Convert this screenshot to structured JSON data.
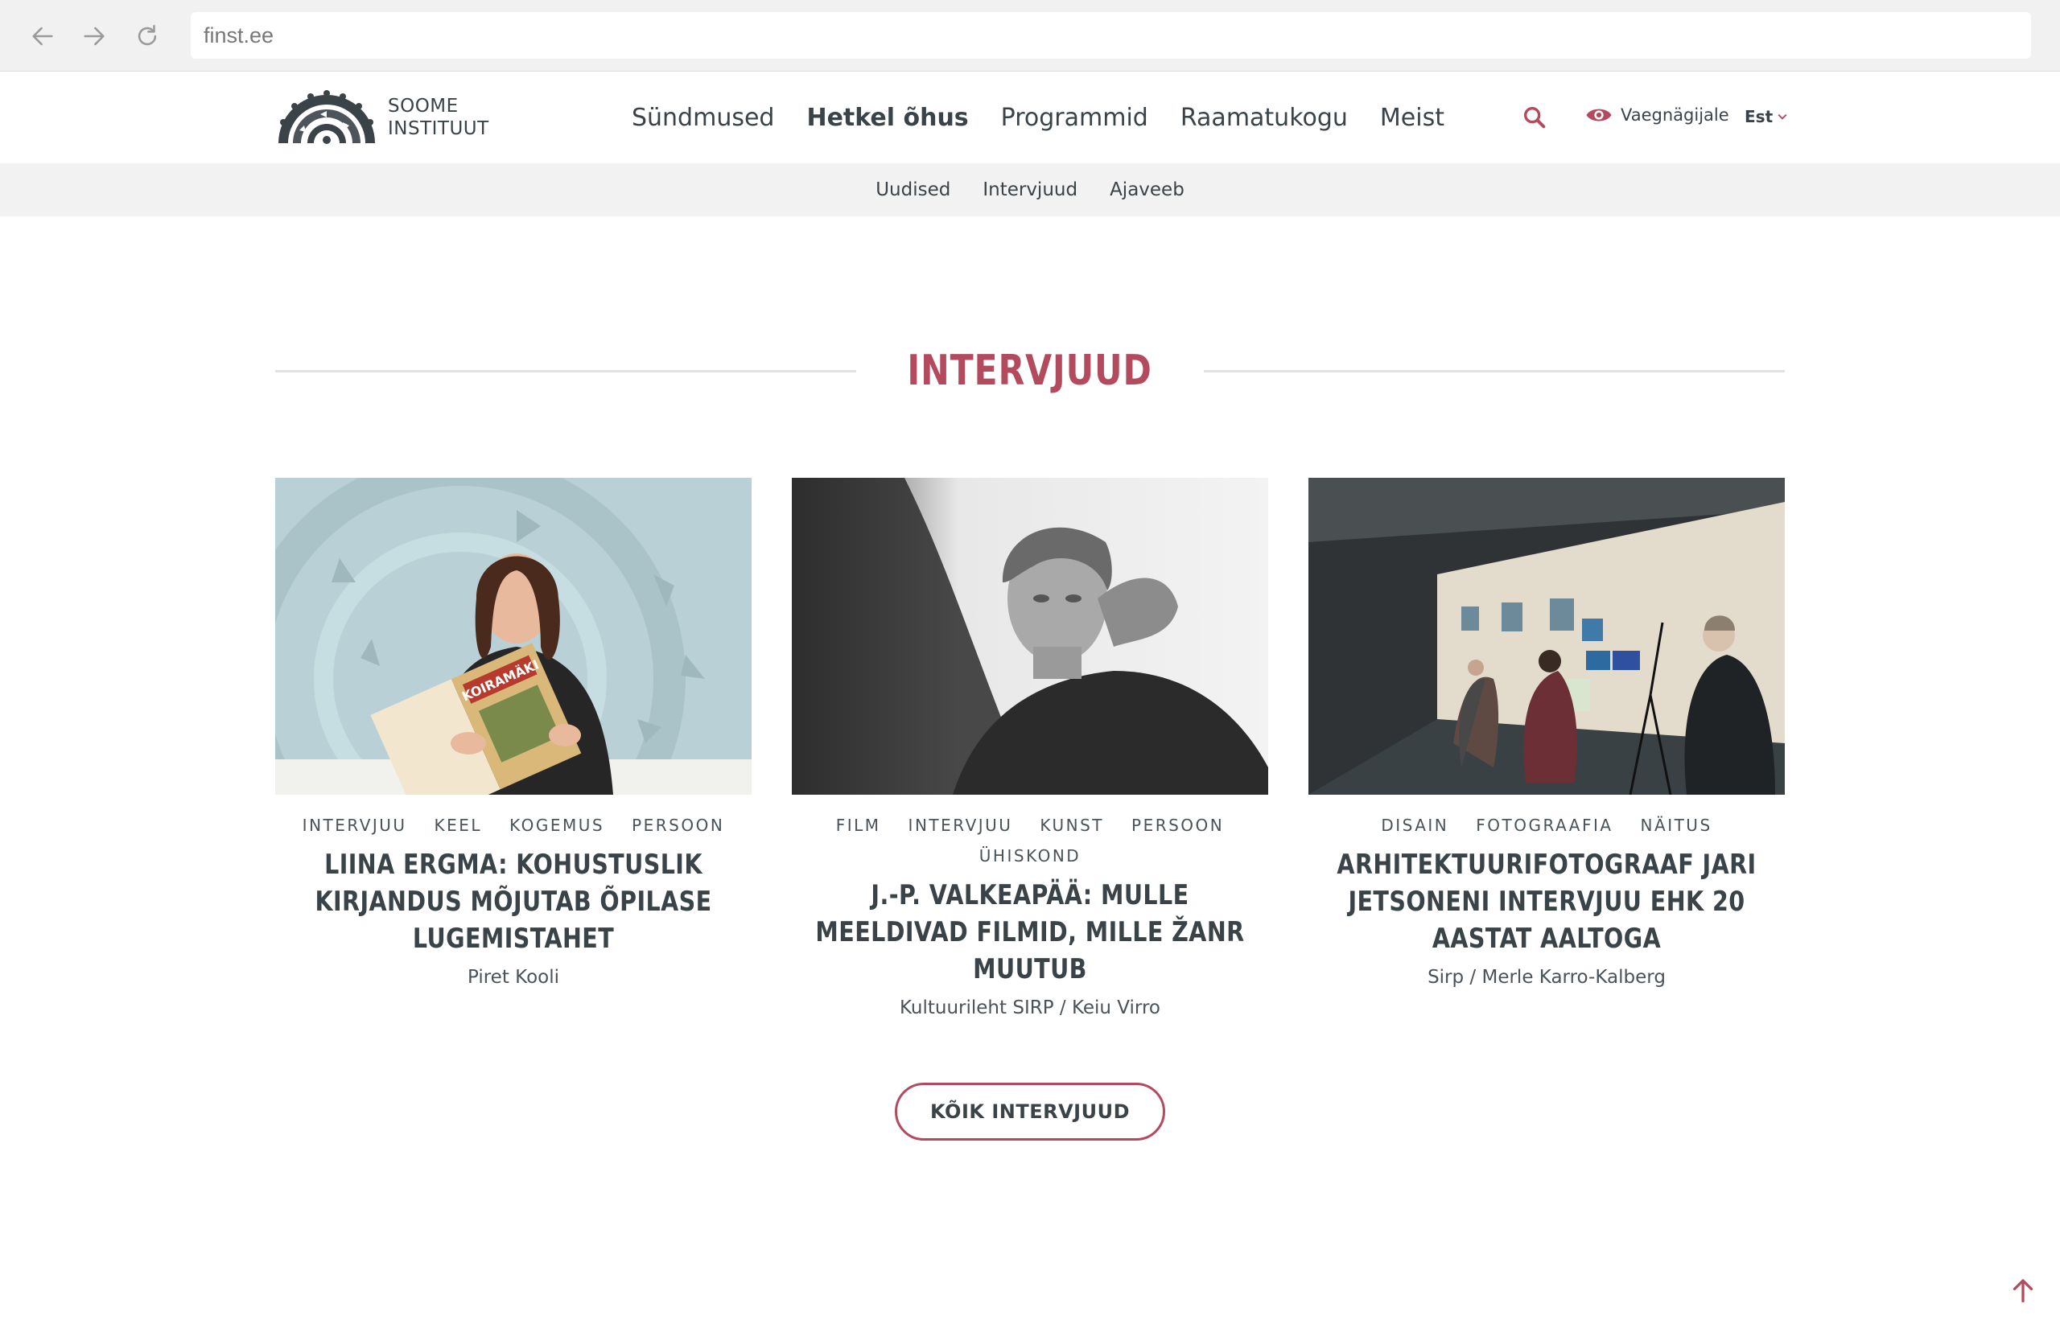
{
  "browser": {
    "url": "finst.ee"
  },
  "header": {
    "logo_line1": "SOOME",
    "logo_line2": "INSTITUUT",
    "nav": [
      {
        "label": "Sündmused"
      },
      {
        "label": "Hetkel õhus"
      },
      {
        "label": "Programmid"
      },
      {
        "label": "Raamatukogu"
      },
      {
        "label": "Meist"
      }
    ],
    "accessibility_label": "Vaegnägijale",
    "language": "Est"
  },
  "subnav": [
    {
      "label": "Uudised"
    },
    {
      "label": "Intervjuud"
    },
    {
      "label": "Ajaveeb"
    }
  ],
  "section": {
    "title": "INTERVJUUD"
  },
  "cards": [
    {
      "tags": [
        "INTERVJUU",
        "KEEL",
        "KOGEMUS",
        "PERSOON"
      ],
      "title": "LIINA ERGMA: KOHUSTUSLIK KIRJANDUS MÕJUTAB ÕPILASE LUGEMISTAHET",
      "author": "Piret Kooli",
      "book_text": "KOIRAMÄKI"
    },
    {
      "tags": [
        "FILM",
        "INTERVJUU",
        "KUNST",
        "PERSOON",
        "ÜHISKOND"
      ],
      "title": "J.-P. VALKEAPÄÄ: MULLE MEELDIVAD FILMID, MILLE ŽANR MUUTUB",
      "author": "Kultuurileht SIRP / Keiu Virro"
    },
    {
      "tags": [
        "DISAIN",
        "FOTOGRAAFIA",
        "NÄITUS"
      ],
      "title": "ARHITEKTUURIFOTOGRAAF JARI JETSONENI INTERVJUU EHK 20 AASTAT AALTOGA",
      "author": "Sirp / Merle Karro-Kalberg"
    }
  ],
  "all_button_label": "KÕIK INTERVJUUD",
  "colors": {
    "accent": "#b44a5e",
    "text": "#3a4348",
    "subnav_bg": "#f2f2f2"
  },
  "icons": {
    "back": "arrow-left-icon",
    "forward": "arrow-right-icon",
    "reload": "reload-icon",
    "search": "search-icon",
    "accessibility": "eye-icon",
    "language": "chevron-down-icon",
    "scroll_top": "arrow-up-icon"
  }
}
